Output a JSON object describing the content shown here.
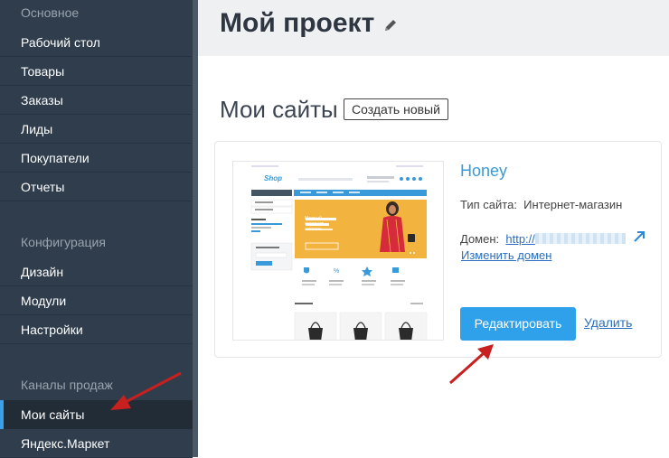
{
  "sidebar": {
    "sections": [
      {
        "heading": "Основное",
        "items": [
          "Рабочий стол",
          "Товары",
          "Заказы",
          "Лиды",
          "Покупатели",
          "Отчеты"
        ]
      },
      {
        "heading": "Конфигурация",
        "items": [
          "Дизайн",
          "Модули",
          "Настройки"
        ]
      },
      {
        "heading": "Каналы продаж",
        "items": [
          "Мои сайты",
          "Яндекс.Маркет"
        ]
      }
    ],
    "active_item": "Мои сайты"
  },
  "header": {
    "title": "Мой проект",
    "edit_icon": "pencil-icon"
  },
  "main": {
    "sites_title": "Мои сайты",
    "create_button": "Создать новый",
    "site": {
      "name": "Honey",
      "type_label": "Тип сайта:",
      "type_value": "Интернет-магазин",
      "domain_label": "Домен:",
      "domain_prefix": "http://",
      "change_domain": "Изменить домен",
      "edit_button": "Редактировать",
      "delete_link": "Удалить",
      "preview": {
        "logo": "Shop",
        "banner_text": "Модный интернет магазин"
      }
    }
  },
  "colors": {
    "sidebar_bg": "#2f3d4c",
    "accent": "#2fa0ea",
    "link": "#2a6ebd",
    "arrow": "#cc2222"
  }
}
